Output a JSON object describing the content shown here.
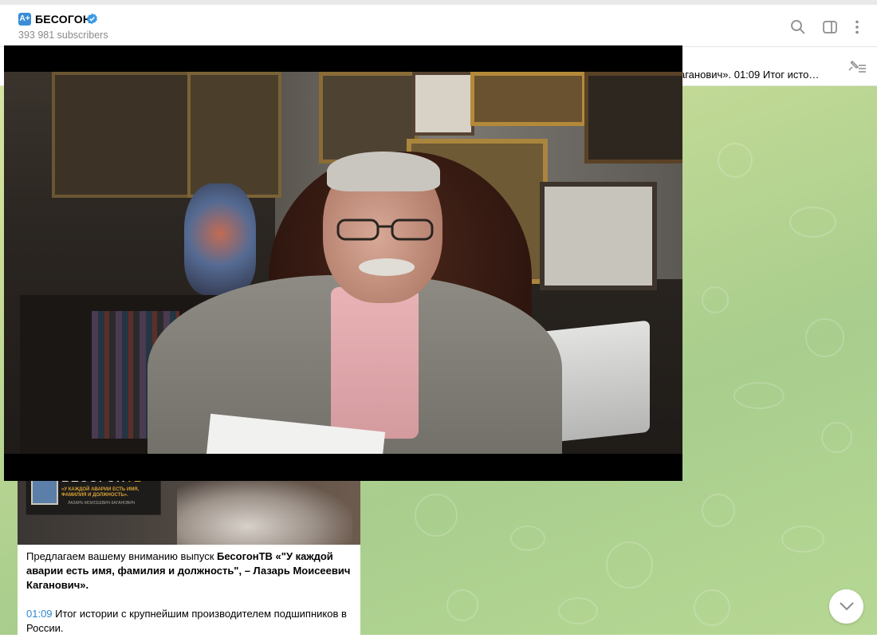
{
  "header": {
    "channel_icon_text": "A+",
    "title": "БЕСОГОН",
    "subscribers": "393 981 subscribers",
    "icons": [
      "search-icon",
      "side-panel-icon",
      "more-icon"
    ]
  },
  "pinned": {
    "text": "аганович». 01:09 Итог исто…",
    "icon": "pinned-list-icon"
  },
  "message": {
    "banner_logo_part1": "БЕСОГОН",
    "banner_logo_part2": "ТВ",
    "banner_subtitle": "«У КАЖДОЙ АВАРИИ ЕСТЬ ИМЯ, ФАМИЛИЯ И ДОЛЖНОСТЬ».",
    "banner_attribution": "ЛАЗАРЬ МОИСЕЕВИЧ КАГАНОВИЧ",
    "text_intro": "Предлагаем вашему вниманию выпуск ",
    "text_bold": "БесогонТВ «\"У каждой аварии есть имя, фамилия и должность\", – Лазарь Моисеевич Каганович».",
    "timestamp": "01:09",
    "timestamp_text": " Итог истории с крупнейшим производителем подшипников в России."
  },
  "colors": {
    "accent": "#2f87d2",
    "channel_icon": "#3b8ed6",
    "chat_bg": "#c3da96"
  }
}
